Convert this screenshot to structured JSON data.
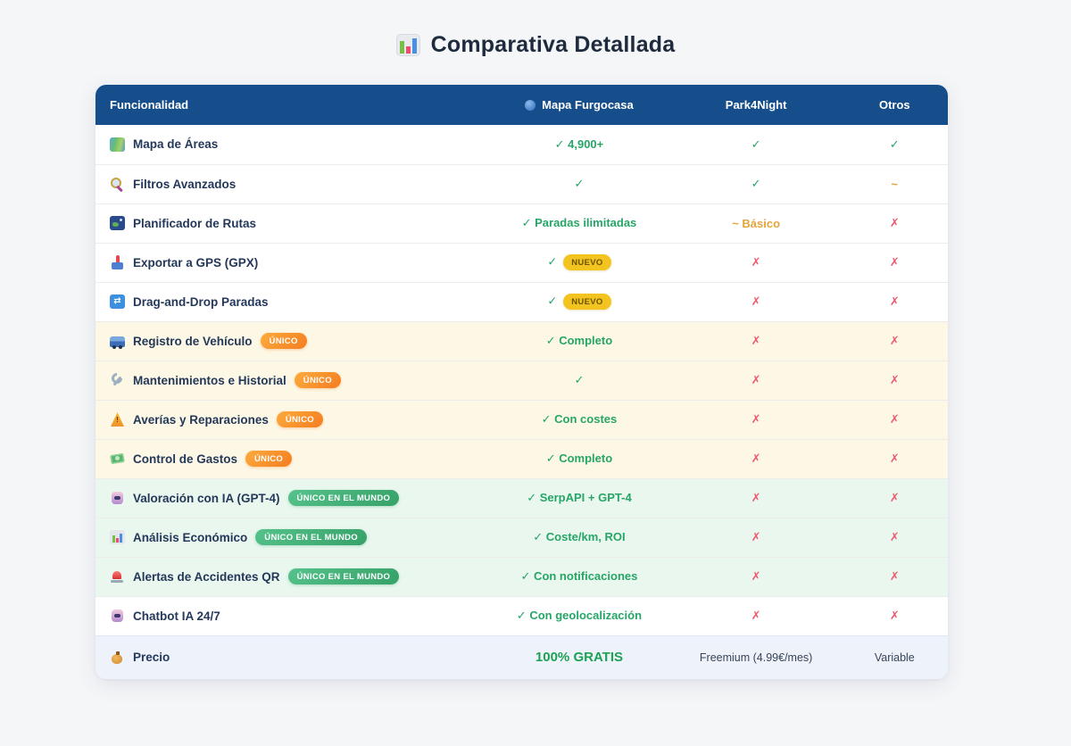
{
  "page": {
    "title": "Comparativa Detallada",
    "title_icon": "bar-chart-icon"
  },
  "badges": {
    "nuevo": "NUEVO",
    "unico": "ÚNICO",
    "unico_mundo": "ÚNICO EN EL MUNDO"
  },
  "marks": {
    "check": "✓",
    "cross": "✗",
    "tilde": "~"
  },
  "colors": {
    "header_bg": "#164e8c",
    "header_text": "#ffffff",
    "check_green": "#27a567",
    "cross_red": "#ee5a6e",
    "tilde_orange": "#e5a43b",
    "row_cream": "#fdf8e6",
    "row_green": "#e9f7ee",
    "row_price": "#edf2fb",
    "badge_unico": "#f57d20",
    "badge_unico_mundo": "#36a269",
    "badge_nuevo": "#f3c41f",
    "free_green": "#1da153",
    "feature_text": "#24385a"
  },
  "table": {
    "columns": [
      {
        "label": "Funcionalidad",
        "icon": null
      },
      {
        "label": "Mapa Furgocasa",
        "icon": "blue-sphere-icon"
      },
      {
        "label": "Park4Night",
        "icon": null
      },
      {
        "label": "Otros",
        "icon": null
      }
    ],
    "rows": [
      {
        "icon": "world-map-icon",
        "feature": "Mapa de Áreas",
        "badge": null,
        "tint": "white",
        "cells": [
          {
            "mark": "check",
            "text": "4,900+",
            "badge": null
          },
          {
            "mark": "check",
            "text": "",
            "badge": null
          },
          {
            "mark": "check",
            "text": "",
            "badge": null
          }
        ]
      },
      {
        "icon": "magnifier-icon",
        "feature": "Filtros Avanzados",
        "badge": null,
        "tint": "white",
        "cells": [
          {
            "mark": "check",
            "text": "",
            "badge": null
          },
          {
            "mark": "check",
            "text": "",
            "badge": null
          },
          {
            "mark": "tilde",
            "text": "",
            "badge": null
          }
        ]
      },
      {
        "icon": "route-map-icon",
        "feature": "Planificador de Rutas",
        "badge": null,
        "tint": "white",
        "cells": [
          {
            "mark": "check",
            "text": "Paradas ilimitadas",
            "badge": null
          },
          {
            "mark": "tilde",
            "text": "Básico",
            "badge": null
          },
          {
            "mark": "cross",
            "text": "",
            "badge": null
          }
        ]
      },
      {
        "icon": "gps-pin-icon",
        "feature": "Exportar a GPS (GPX)",
        "badge": null,
        "tint": "white",
        "cells": [
          {
            "mark": "check",
            "text": "",
            "badge": "nuevo"
          },
          {
            "mark": "cross",
            "text": "",
            "badge": null
          },
          {
            "mark": "cross",
            "text": "",
            "badge": null
          }
        ]
      },
      {
        "icon": "shuffle-arrows-icon",
        "feature": "Drag-and-Drop Paradas",
        "badge": null,
        "tint": "white",
        "cells": [
          {
            "mark": "check",
            "text": "",
            "badge": "nuevo"
          },
          {
            "mark": "cross",
            "text": "",
            "badge": null
          },
          {
            "mark": "cross",
            "text": "",
            "badge": null
          }
        ]
      },
      {
        "icon": "van-icon",
        "feature": "Registro de Vehículo",
        "badge": "unico",
        "tint": "cream",
        "cells": [
          {
            "mark": "check",
            "text": "Completo",
            "badge": null
          },
          {
            "mark": "cross",
            "text": "",
            "badge": null
          },
          {
            "mark": "cross",
            "text": "",
            "badge": null
          }
        ]
      },
      {
        "icon": "wrench-icon",
        "feature": "Mantenimientos e Historial",
        "badge": "unico",
        "tint": "cream",
        "cells": [
          {
            "mark": "check",
            "text": "",
            "badge": null
          },
          {
            "mark": "cross",
            "text": "",
            "badge": null
          },
          {
            "mark": "cross",
            "text": "",
            "badge": null
          }
        ]
      },
      {
        "icon": "warning-icon",
        "feature": "Averías y Reparaciones",
        "badge": "unico",
        "tint": "cream",
        "cells": [
          {
            "mark": "check",
            "text": "Con costes",
            "badge": null
          },
          {
            "mark": "cross",
            "text": "",
            "badge": null
          },
          {
            "mark": "cross",
            "text": "",
            "badge": null
          }
        ]
      },
      {
        "icon": "banknote-icon",
        "feature": "Control de Gastos",
        "badge": "unico",
        "tint": "cream",
        "cells": [
          {
            "mark": "check",
            "text": "Completo",
            "badge": null
          },
          {
            "mark": "cross",
            "text": "",
            "badge": null
          },
          {
            "mark": "cross",
            "text": "",
            "badge": null
          }
        ]
      },
      {
        "icon": "robot-icon",
        "feature": "Valoración con IA (GPT-4)",
        "badge": "unico_mundo",
        "tint": "green",
        "cells": [
          {
            "mark": "check",
            "text": "SerpAPI + GPT-4",
            "badge": null
          },
          {
            "mark": "cross",
            "text": "",
            "badge": null
          },
          {
            "mark": "cross",
            "text": "",
            "badge": null
          }
        ]
      },
      {
        "icon": "bar-chart-icon",
        "feature": "Análisis Económico",
        "badge": "unico_mundo",
        "tint": "green",
        "cells": [
          {
            "mark": "check",
            "text": "Coste/km, ROI",
            "badge": null
          },
          {
            "mark": "cross",
            "text": "",
            "badge": null
          },
          {
            "mark": "cross",
            "text": "",
            "badge": null
          }
        ]
      },
      {
        "icon": "siren-icon",
        "feature": "Alertas de Accidentes QR",
        "badge": "unico_mundo",
        "tint": "green",
        "cells": [
          {
            "mark": "check",
            "text": "Con notificaciones",
            "badge": null
          },
          {
            "mark": "cross",
            "text": "",
            "badge": null
          },
          {
            "mark": "cross",
            "text": "",
            "badge": null
          }
        ]
      },
      {
        "icon": "robot-icon",
        "feature": "Chatbot IA 24/7",
        "badge": null,
        "tint": "white",
        "cells": [
          {
            "mark": "check",
            "text": "Con geolocalización",
            "badge": null
          },
          {
            "mark": "cross",
            "text": "",
            "badge": null
          },
          {
            "mark": "cross",
            "text": "",
            "badge": null
          }
        ]
      }
    ],
    "footer": {
      "icon": "money-bag-icon",
      "feature": "Precio",
      "cells": [
        {
          "text": "100% GRATIS",
          "style": "free"
        },
        {
          "text": "Freemium (4.99€/mes)",
          "style": "plain"
        },
        {
          "text": "Variable",
          "style": "plain"
        }
      ]
    }
  }
}
